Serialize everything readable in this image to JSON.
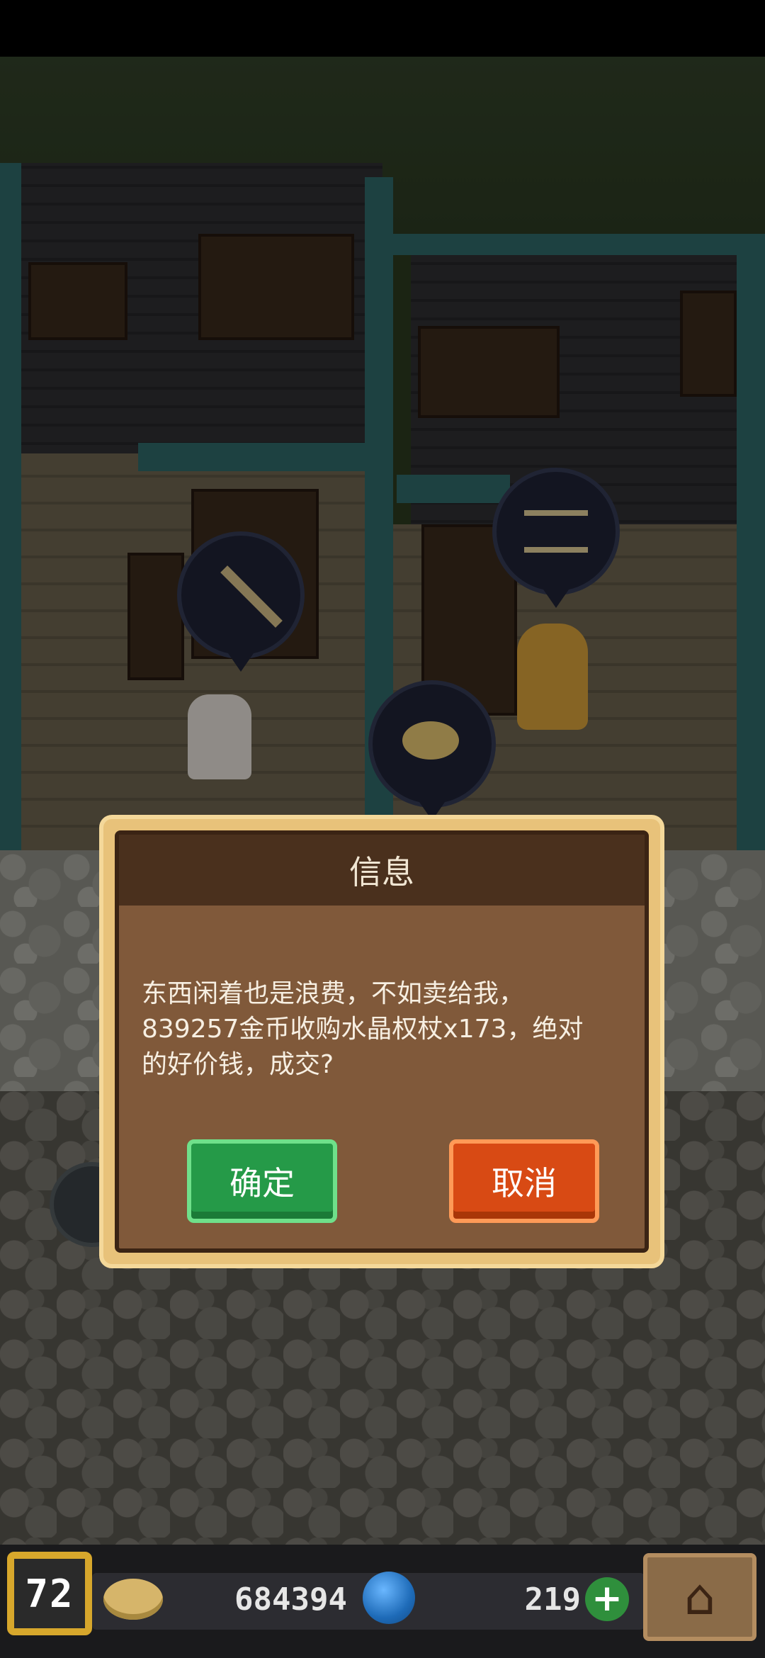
{
  "dialog": {
    "title": "信息",
    "message_lines": [
      "东西闲着也是浪费，不如卖给我，",
      "839257金币收购水晶权杖x173，绝对",
      "的好价钱，成交?"
    ],
    "confirm_label": "确定",
    "cancel_label": "取消"
  },
  "hud": {
    "level": "72",
    "coins": "684394",
    "gems": "219",
    "add_label": "+",
    "home_icon": "house-icon"
  },
  "colors": {
    "confirm": "#259a48",
    "cancel": "#d84a14",
    "dialog_border": "#e8c27a",
    "level_badge": "#d7a72c"
  }
}
